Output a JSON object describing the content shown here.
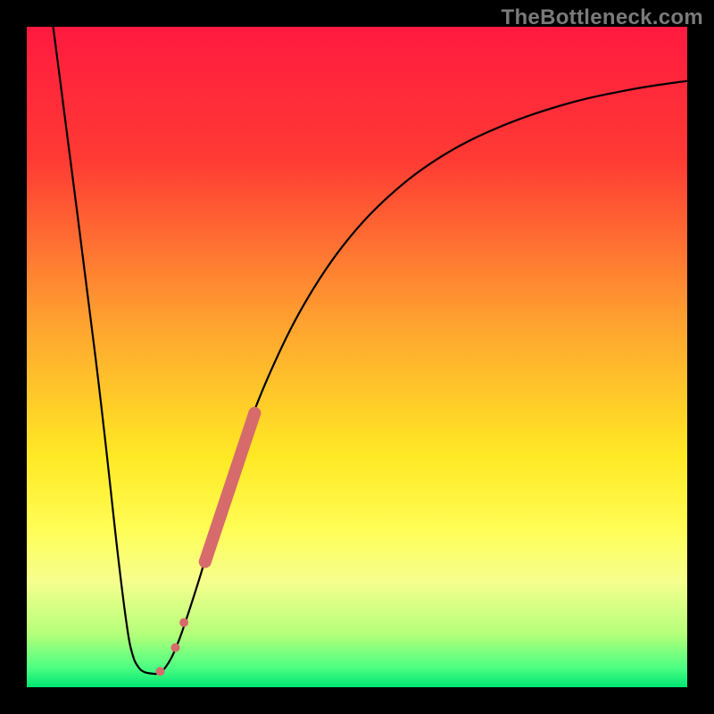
{
  "watermark": "TheBottleneck.com",
  "chart_data": {
    "type": "line",
    "title": "",
    "xlabel": "",
    "ylabel": "",
    "xlim": [
      0,
      100
    ],
    "ylim": [
      0,
      100
    ],
    "gradient_stops": [
      {
        "offset": 0,
        "color": "#ff1a40"
      },
      {
        "offset": 20,
        "color": "#ff3a34"
      },
      {
        "offset": 45,
        "color": "#ffa330"
      },
      {
        "offset": 65,
        "color": "#ffe924"
      },
      {
        "offset": 76,
        "color": "#fffd55"
      },
      {
        "offset": 84,
        "color": "#f6ff8e"
      },
      {
        "offset": 92,
        "color": "#b4ff7a"
      },
      {
        "offset": 97,
        "color": "#4dff82"
      },
      {
        "offset": 100,
        "color": "#00e573"
      }
    ],
    "series": [
      {
        "name": "left-descent",
        "color": "#000000",
        "stroke_width": 2.2,
        "points": [
          {
            "x": 4.0,
            "y": 100.0
          },
          {
            "x": 10.4,
            "y": 50.0
          },
          {
            "x": 13.8,
            "y": 20.0
          },
          {
            "x": 15.2,
            "y": 9.0
          },
          {
            "x": 16.0,
            "y": 5.0
          },
          {
            "x": 16.8,
            "y": 3.2
          },
          {
            "x": 17.8,
            "y": 2.3
          },
          {
            "x": 19.5,
            "y": 2.0
          }
        ]
      },
      {
        "name": "right-ascent",
        "color": "#000000",
        "stroke_width": 2.2,
        "points": [
          {
            "x": 19.5,
            "y": 2.0
          },
          {
            "x": 21.0,
            "y": 3.0
          },
          {
            "x": 23.0,
            "y": 7.0
          },
          {
            "x": 26.0,
            "y": 16.0
          },
          {
            "x": 29.0,
            "y": 26.0
          },
          {
            "x": 33.0,
            "y": 38.0
          },
          {
            "x": 37.0,
            "y": 48.0
          },
          {
            "x": 42.0,
            "y": 58.0
          },
          {
            "x": 48.0,
            "y": 67.0
          },
          {
            "x": 55.0,
            "y": 74.5
          },
          {
            "x": 63.0,
            "y": 80.5
          },
          {
            "x": 72.0,
            "y": 85.0
          },
          {
            "x": 82.0,
            "y": 88.4
          },
          {
            "x": 92.0,
            "y": 90.6
          },
          {
            "x": 100.0,
            "y": 91.8
          }
        ]
      },
      {
        "name": "highlight-band",
        "color": "#d76b6b",
        "type": "thick",
        "stroke_width": 14,
        "points": [
          {
            "x": 27.0,
            "y": 19.0
          },
          {
            "x": 34.5,
            "y": 41.5
          }
        ]
      }
    ],
    "markers": [
      {
        "name": "dot-1",
        "x": 23.8,
        "y": 9.8,
        "r": 5.0,
        "color": "#d76b6b"
      },
      {
        "name": "dot-2",
        "x": 22.5,
        "y": 6.0,
        "r": 5.0,
        "color": "#d76b6b"
      },
      {
        "name": "dot-3",
        "x": 20.2,
        "y": 2.4,
        "r": 5.0,
        "color": "#d76b6b"
      },
      {
        "name": "band-top-cap",
        "x": 34.5,
        "y": 41.5,
        "r": 7.0,
        "color": "#d76b6b"
      },
      {
        "name": "band-bottom-cap",
        "x": 27.0,
        "y": 19.0,
        "r": 7.0,
        "color": "#d76b6b"
      }
    ]
  }
}
